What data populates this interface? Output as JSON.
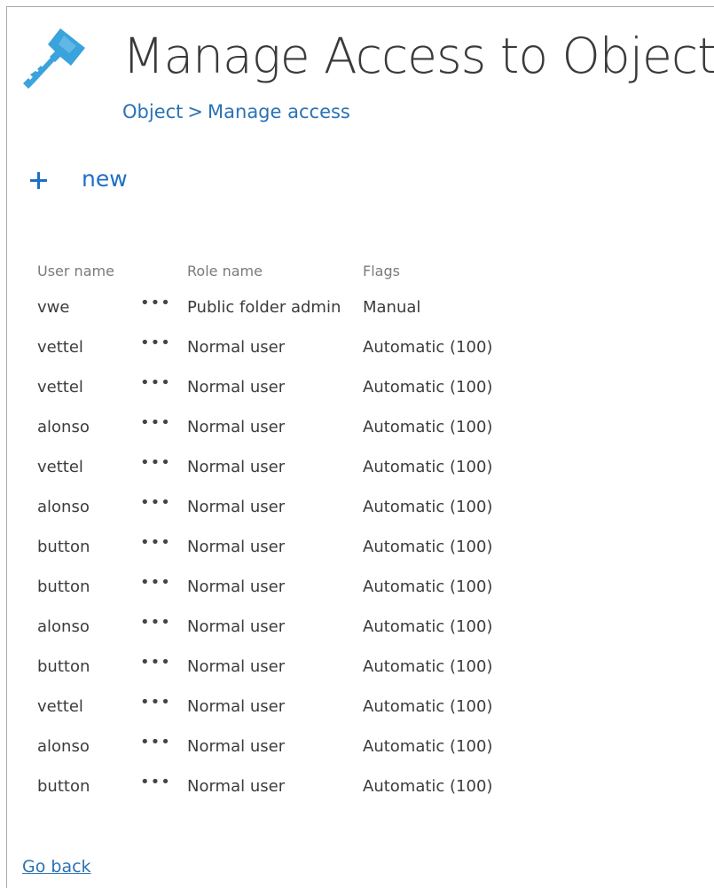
{
  "header": {
    "title": "Manage Access to Object",
    "icon": "key-icon"
  },
  "breadcrumb": {
    "parent": "Object",
    "separator": ">",
    "current": "Manage access"
  },
  "toolbar": {
    "new_icon": "plus-icon",
    "new_label": "new"
  },
  "table": {
    "columns": [
      "User name",
      "",
      "Role name",
      "Flags"
    ],
    "row_menu_glyph": "•••",
    "rows": [
      {
        "user": "vwe",
        "role": "Public folder admin",
        "flags": "Manual"
      },
      {
        "user": "vettel",
        "role": "Normal user",
        "flags": "Automatic (100)"
      },
      {
        "user": "vettel",
        "role": "Normal user",
        "flags": "Automatic (100)"
      },
      {
        "user": "alonso",
        "role": "Normal user",
        "flags": "Automatic (100)"
      },
      {
        "user": "vettel",
        "role": "Normal user",
        "flags": "Automatic (100)"
      },
      {
        "user": "alonso",
        "role": "Normal user",
        "flags": "Automatic (100)"
      },
      {
        "user": "button",
        "role": "Normal user",
        "flags": "Automatic (100)"
      },
      {
        "user": "button",
        "role": "Normal user",
        "flags": "Automatic (100)"
      },
      {
        "user": "alonso",
        "role": "Normal user",
        "flags": "Automatic (100)"
      },
      {
        "user": "button",
        "role": "Normal user",
        "flags": "Automatic (100)"
      },
      {
        "user": "vettel",
        "role": "Normal user",
        "flags": "Automatic (100)"
      },
      {
        "user": "alonso",
        "role": "Normal user",
        "flags": "Automatic (100)"
      },
      {
        "user": "button",
        "role": "Normal user",
        "flags": "Automatic (100)"
      }
    ]
  },
  "footer": {
    "go_back_label": "Go back"
  },
  "colors": {
    "link": "#2a72b5",
    "accent": "#1f6fc5",
    "key_icon": "#3aa3dc"
  }
}
